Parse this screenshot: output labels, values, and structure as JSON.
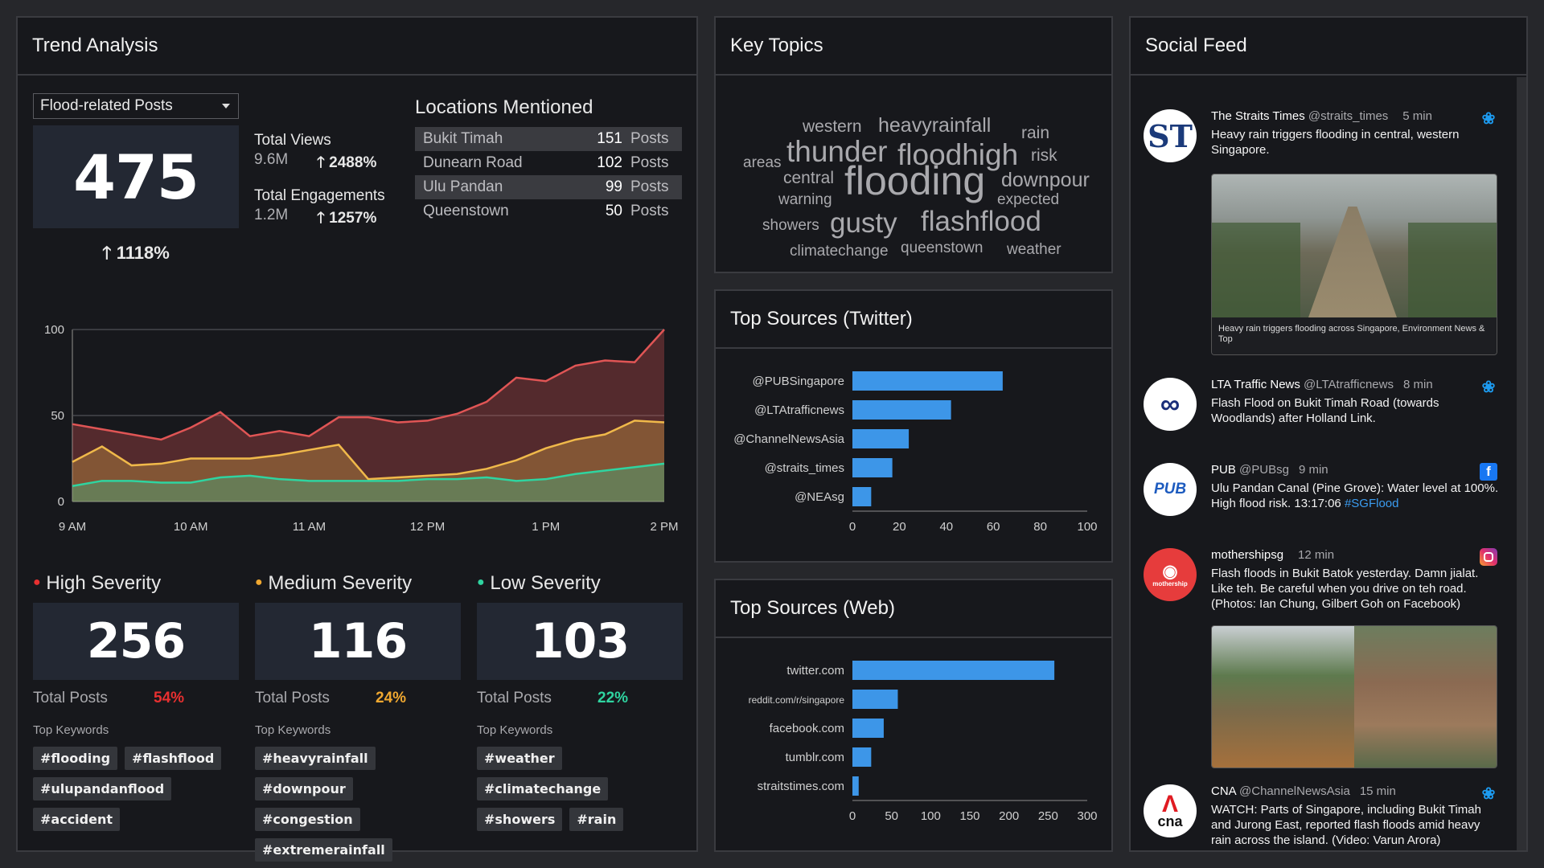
{
  "trend": {
    "title": "Trend Analysis",
    "dropdown": "Flood-related Posts",
    "total_posts": "475",
    "total_change": "1118%",
    "views_label": "Total Views",
    "views_value": "9.6M",
    "views_change": "2488%",
    "eng_label": "Total Engagements",
    "eng_value": "1.2M",
    "eng_change": "1257%",
    "locations_title": "Locations Mentioned",
    "posts_word": "Posts",
    "locations": [
      {
        "name": "Bukit Timah",
        "count": "151"
      },
      {
        "name": "Dunearn Road",
        "count": "102"
      },
      {
        "name": "Ulu Pandan",
        "count": "99"
      },
      {
        "name": "Queenstown",
        "count": "50"
      }
    ]
  },
  "chart_data": [
    {
      "type": "area",
      "x": [
        "9 AM",
        "10 AM",
        "11 AM",
        "12 PM",
        "1 PM",
        "2 PM"
      ],
      "ylim": [
        0,
        100
      ],
      "yticks": [
        0,
        50,
        100
      ],
      "x_points": [
        0,
        0.25,
        0.5,
        0.75,
        1,
        1.25,
        1.5,
        1.75,
        2,
        2.25,
        2.5,
        2.75,
        3,
        3.25,
        3.5,
        3.75,
        4,
        4.25,
        4.5,
        4.75,
        5
      ],
      "series": [
        {
          "color": "#e05555",
          "values": [
            45,
            42,
            39,
            36,
            43,
            52,
            38,
            41,
            38,
            49,
            49,
            46,
            47,
            51,
            58,
            72,
            70,
            79,
            82,
            81,
            100
          ]
        },
        {
          "color": "#f0b94a",
          "values": [
            23,
            32,
            21,
            22,
            25,
            25,
            25,
            27,
            30,
            33,
            13,
            14,
            15,
            16,
            19,
            24,
            31,
            36,
            39,
            47,
            46
          ]
        },
        {
          "color": "#2fd4a0",
          "values": [
            9,
            12,
            12,
            11,
            11,
            14,
            15,
            13,
            12,
            12,
            12,
            12,
            13,
            13,
            14,
            12,
            13,
            16,
            18,
            20,
            22
          ]
        }
      ]
    },
    {
      "type": "bar",
      "title": "Top Sources (Twitter)",
      "categories": [
        "@PUBSingapore",
        "@LTAtrafficnews",
        "@ChannelNewsAsia",
        "@straits_times",
        "@NEAsg"
      ],
      "values": [
        64,
        42,
        24,
        17,
        8
      ],
      "xlim": [
        0,
        100
      ],
      "xticks": [
        0,
        20,
        40,
        60,
        80,
        100
      ]
    },
    {
      "type": "bar",
      "title": "Top Sources (Web)",
      "categories": [
        "twitter.com",
        "reddit.com/r/singapore",
        "facebook.com",
        "tumblr.com",
        "straitstimes.com"
      ],
      "values": [
        258,
        58,
        40,
        24,
        8
      ],
      "xlim": [
        0,
        300
      ],
      "xticks": [
        0,
        50,
        100,
        150,
        200,
        250,
        300
      ]
    }
  ],
  "severity": [
    {
      "label": "High Severity",
      "color": "#e83030",
      "value": "256",
      "posts_label": "Total Posts",
      "pct": "54%",
      "kw_label": "Top Keywords",
      "tags": [
        "#flooding",
        "#flashflood",
        "#ulupandanflood",
        "#accident"
      ]
    },
    {
      "label": "Medium Severity",
      "color": "#f0a830",
      "value": "116",
      "posts_label": "Total Posts",
      "pct": "24%",
      "kw_label": "Top Keywords",
      "tags": [
        "#heavyrainfall",
        "#downpour",
        "#congestion",
        "#extremerainfall"
      ]
    },
    {
      "label": "Low Severity",
      "color": "#2fd4a0",
      "value": "103",
      "posts_label": "Total Posts",
      "pct": "22%",
      "kw_label": "Top Keywords",
      "tags": [
        "#weather",
        "#climatechange",
        "#showers",
        "#rain"
      ]
    }
  ],
  "topics": {
    "title": "Key Topics",
    "words": [
      "western",
      "heavyrainfall",
      "rain",
      "areas",
      "thunder",
      "floodhigh",
      "risk",
      "central",
      "flooding",
      "downpour",
      "warning",
      "expected",
      "showers",
      "gusty",
      "flashflood",
      "climatechange",
      "queenstown",
      "weather"
    ]
  },
  "feed": {
    "title": "Social Feed",
    "items": [
      {
        "name": "The Straits Times",
        "handle": "@straits_times",
        "time": "5 min",
        "avatar": "ST",
        "icon": "twitter-icon",
        "text": "Heavy rain triggers flooding in central, western Singapore.",
        "caption": "Heavy rain triggers flooding across Singapore, Environment News & Top"
      },
      {
        "name": "LTA Traffic News",
        "handle": "@LTAtrafficnews",
        "time": "8 min",
        "avatar": "LTA",
        "icon": "twitter-icon",
        "text": "Flash Flood on Bukit Timah Road (towards Woodlands) after Holland Link."
      },
      {
        "name": "PUB",
        "handle": "@PUBsg",
        "time": "9 min",
        "avatar": "PUB",
        "icon": "facebook-icon",
        "text": "Ulu Pandan Canal (Pine Grove): Water level at 100%. High flood risk. 13:17:06",
        "hashtag": "#SGFlood"
      },
      {
        "name": "mothershipsg",
        "handle": "",
        "time": "12 min",
        "avatar": "mothership",
        "icon": "instagram-icon",
        "text": "Flash floods in Bukit Batok yesterday. Damn jialat. Like teh. Be careful when you drive on teh road. (Photos: Ian Chung, Gilbert Goh on Facebook)"
      },
      {
        "name": "CNA",
        "handle": "@ChannelNewsAsia",
        "time": "15 min",
        "avatar": "cna",
        "icon": "twitter-icon",
        "text": "WATCH: Parts of Singapore, including Bukit Timah and Jurong East, reported flash floods amid heavy rain across the island. (Video: Varun Arora)"
      }
    ]
  }
}
